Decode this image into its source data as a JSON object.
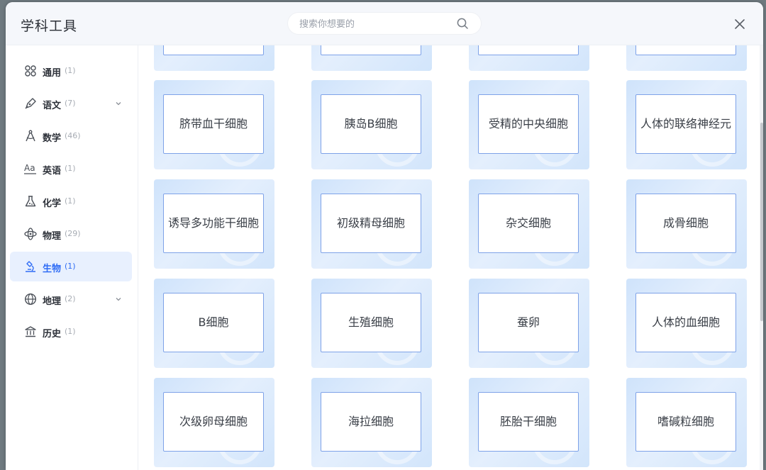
{
  "header": {
    "title": "学科工具",
    "search_placeholder": "搜索你想要的",
    "search_icon": "search-icon",
    "close_icon": "close-icon"
  },
  "sidebar": {
    "items": [
      {
        "label": "通用",
        "count": "(1)",
        "icon": "grid-icon",
        "active": false,
        "expandable": false
      },
      {
        "label": "语文",
        "count": "(7)",
        "icon": "pen-icon",
        "active": false,
        "expandable": true
      },
      {
        "label": "数学",
        "count": "(46)",
        "icon": "compass-icon",
        "active": false,
        "expandable": false
      },
      {
        "label": "英语",
        "count": "(1)",
        "icon": "letters-icon",
        "active": false,
        "expandable": false
      },
      {
        "label": "化学",
        "count": "(1)",
        "icon": "flask-icon",
        "active": false,
        "expandable": false
      },
      {
        "label": "物理",
        "count": "(29)",
        "icon": "atom-icon",
        "active": false,
        "expandable": false
      },
      {
        "label": "生物",
        "count": "(1)",
        "icon": "microscope-icon",
        "active": true,
        "expandable": false
      },
      {
        "label": "地理",
        "count": "(2)",
        "icon": "globe-icon",
        "active": false,
        "expandable": true
      },
      {
        "label": "历史",
        "count": "(1)",
        "icon": "temple-icon",
        "active": false,
        "expandable": false
      }
    ]
  },
  "cards": [
    "脐带血干细胞",
    "胰岛B细胞",
    "受精的中央细胞",
    "人体的联络神经元",
    "诱导多功能干细胞",
    "初级精母细胞",
    "杂交细胞",
    "成骨细胞",
    "B细胞",
    "生殖细胞",
    "蚕卵",
    "人体的血细胞",
    "次级卵母细胞",
    "海拉细胞",
    "胚胎干细胞",
    "嗜碱粒细胞"
  ],
  "colors": {
    "accent": "#2f6cf5",
    "active_bg": "#e8f0fe",
    "card_border": "#7ea2e8"
  }
}
